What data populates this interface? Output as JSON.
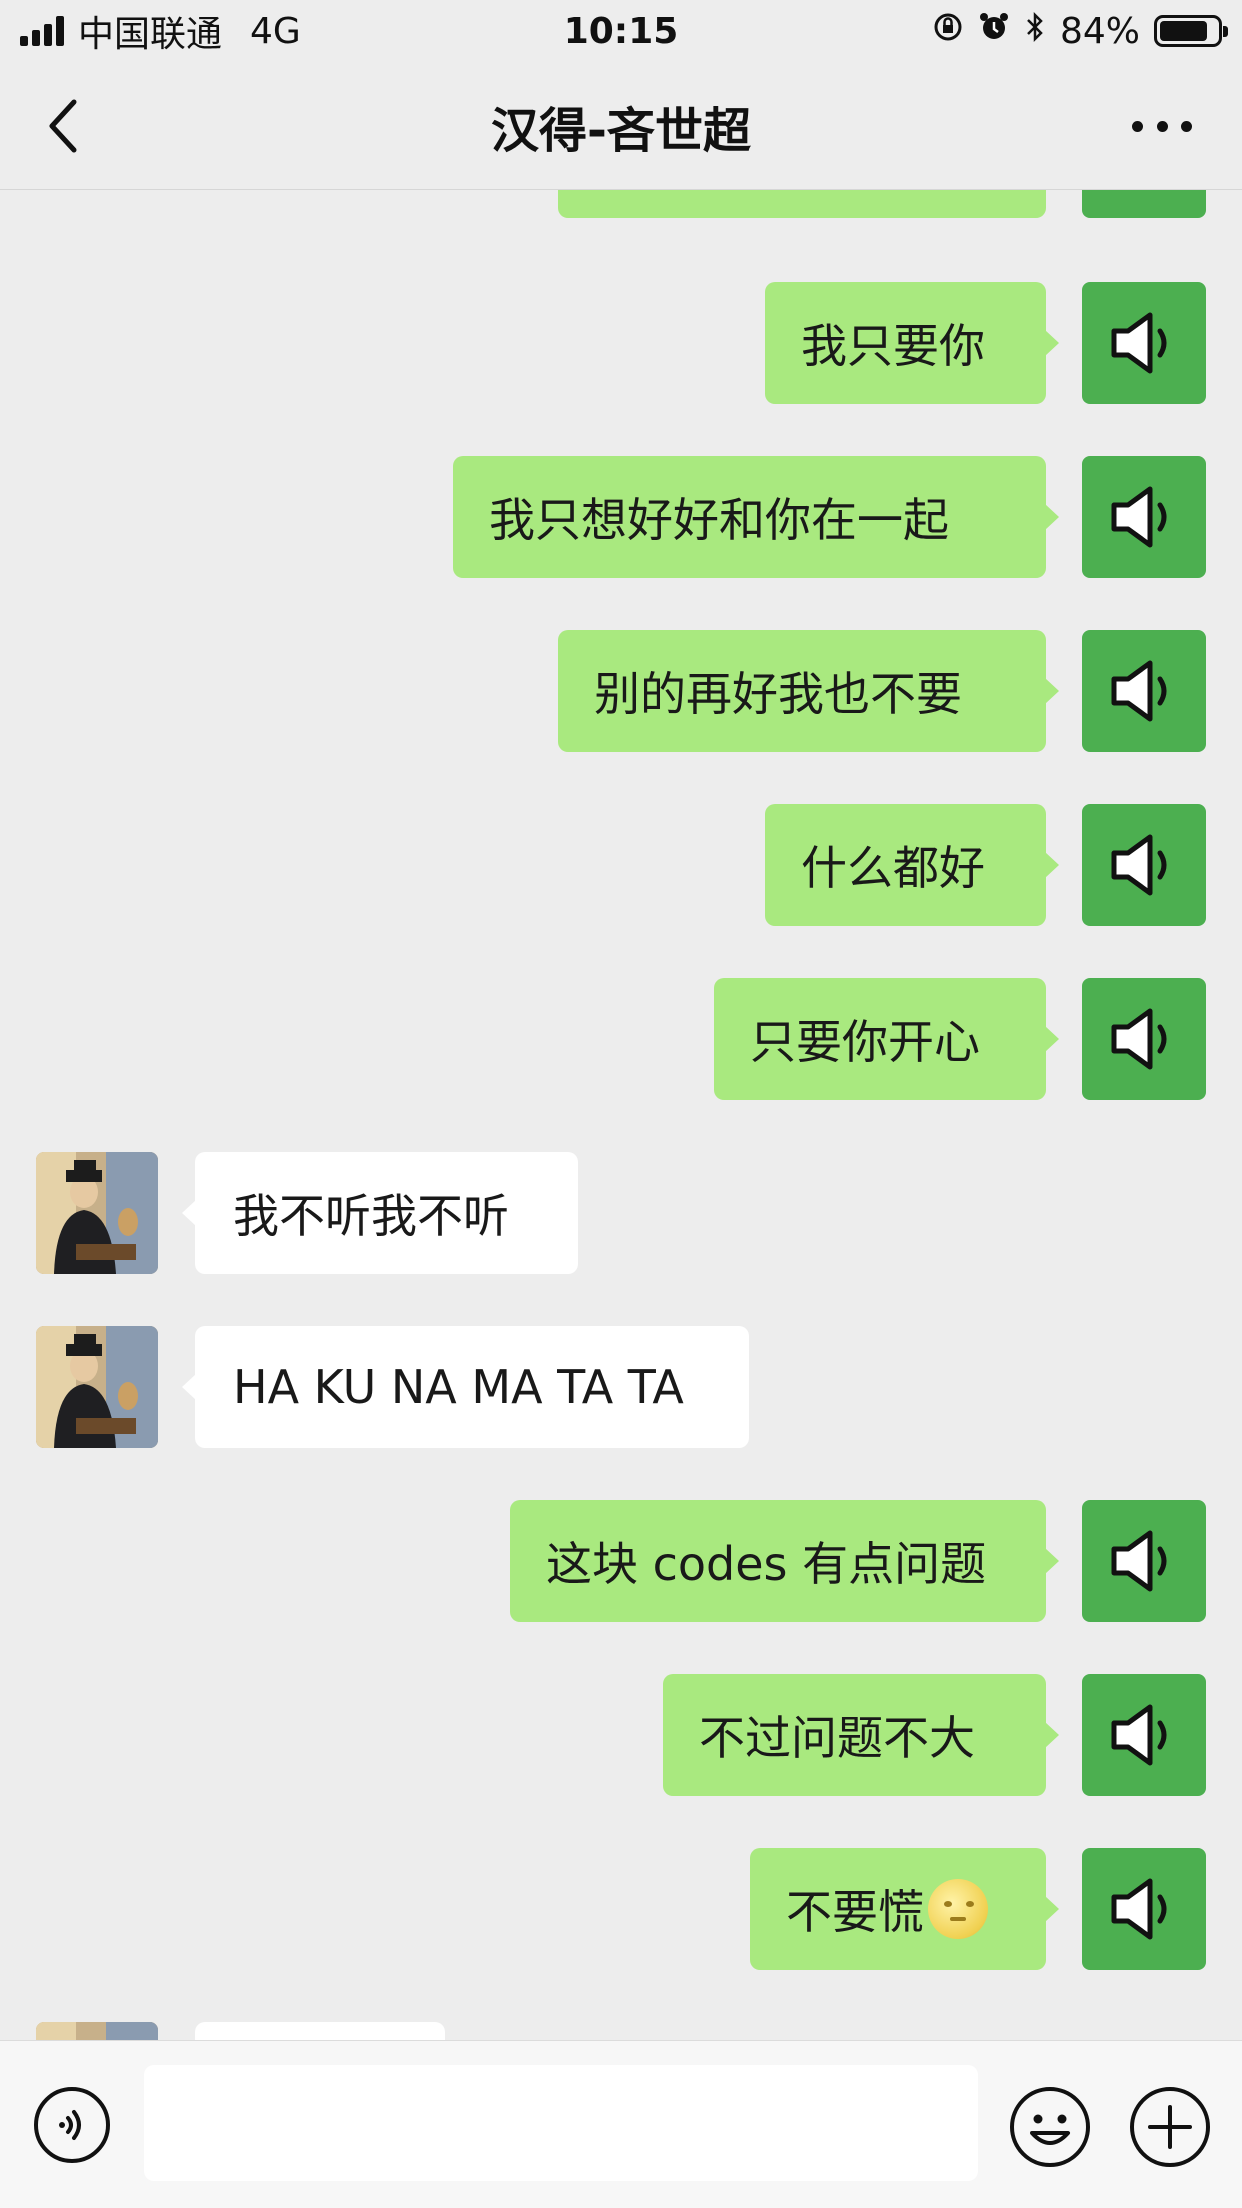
{
  "status_bar": {
    "carrier": "中国联通",
    "network": "4G",
    "time": "10:15",
    "battery": "84%",
    "battery_level": 0.84
  },
  "nav": {
    "title": "汉得-吝世超"
  },
  "messages": [
    {
      "side": "mine",
      "text": "",
      "type": "voice"
    },
    {
      "side": "mine",
      "text": "我只要你",
      "type": "voice"
    },
    {
      "side": "mine",
      "text": "我只想好好和你在一起",
      "type": "voice"
    },
    {
      "side": "mine",
      "text": "别的再好我也不要",
      "type": "voice"
    },
    {
      "side": "mine",
      "text": "什么都好",
      "type": "voice"
    },
    {
      "side": "mine",
      "text": "只要你开心",
      "type": "voice"
    },
    {
      "side": "theirs",
      "text": "我不听我不听"
    },
    {
      "side": "theirs",
      "text": "HA KU NA MA TA TA"
    },
    {
      "side": "mine",
      "text": "这块 codes 有点问题",
      "type": "voice"
    },
    {
      "side": "mine",
      "text": "不过问题不大",
      "type": "voice"
    },
    {
      "side": "mine",
      "text": "不要慌",
      "type": "voice",
      "emoji": "full-moon-face"
    },
    {
      "side": "theirs",
      "text": ""
    }
  ],
  "input": {
    "value": "",
    "placeholder": ""
  },
  "colors": {
    "background": "#ededed",
    "my_bubble": "#a9e97f",
    "their_bubble": "#ffffff",
    "voice_avatar": "#4caf50"
  },
  "icons": {
    "back": "chevron-left-icon",
    "more": "more-dots-icon",
    "voice_message": "speaker-icon",
    "voice_input": "voice-input-icon",
    "emoji": "smiley-icon",
    "plus": "plus-circle-icon"
  }
}
